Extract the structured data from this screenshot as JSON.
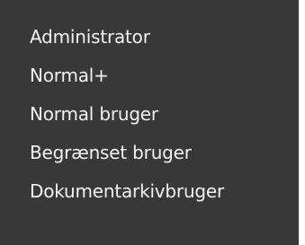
{
  "menu": {
    "items": [
      {
        "label": "Administrator"
      },
      {
        "label": "Normal+"
      },
      {
        "label": "Normal bruger"
      },
      {
        "label": "Begrænset bruger"
      },
      {
        "label": "Dokumentarkivbruger"
      }
    ]
  },
  "colors": {
    "menu_background": "#383838",
    "menu_text": "#f2f2f2"
  }
}
